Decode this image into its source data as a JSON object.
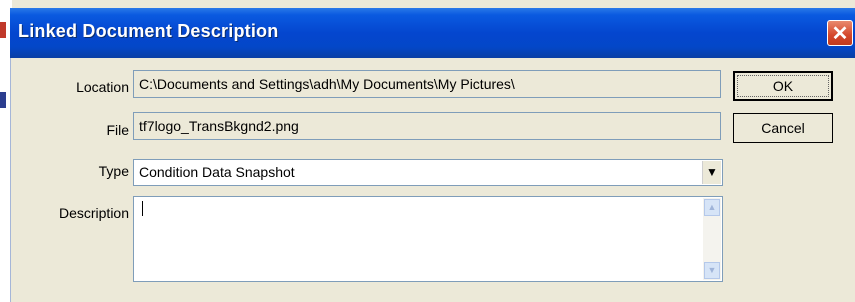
{
  "window": {
    "title": "Linked Document Description",
    "close_glyph": "✕"
  },
  "form": {
    "location_label": "Location",
    "location_value": "C:\\Documents and Settings\\adh\\My Documents\\My Pictures\\",
    "file_label": "File",
    "file_value": "tf7logo_TransBkgnd2.png",
    "type_label": "Type",
    "type_value": "Condition Data Snapshot",
    "description_label": "Description",
    "description_value": ""
  },
  "buttons": {
    "ok_label": "OK",
    "cancel_label": "Cancel"
  },
  "icons": {
    "dropdown": "▼",
    "scroll_up": "▲",
    "scroll_down": "▼"
  },
  "colors": {
    "titlebar": "#0446cf",
    "face": "#ece9d8",
    "close": "#d4462a",
    "border": "#7f9db9"
  }
}
